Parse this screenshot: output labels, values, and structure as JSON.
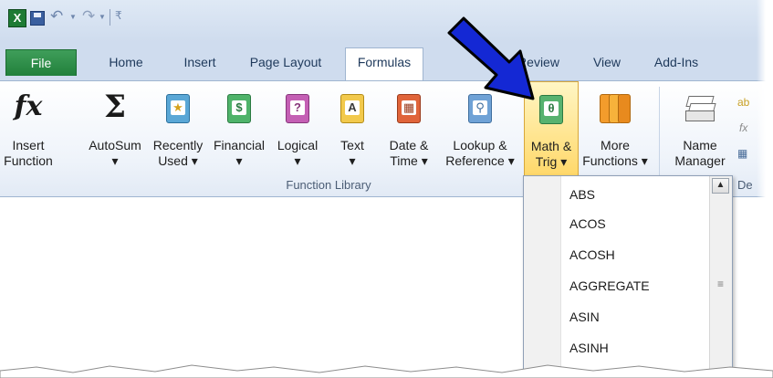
{
  "qat": {
    "app_icon_letter": "X",
    "icons": [
      "excel-app-icon",
      "save-icon",
      "undo-icon",
      "redo-icon",
      "customize-qat-icon"
    ]
  },
  "tabs": [
    {
      "label": "File"
    },
    {
      "label": "Home"
    },
    {
      "label": "Insert"
    },
    {
      "label": "Page Layout"
    },
    {
      "label": "Formulas"
    },
    {
      "label": "Review"
    },
    {
      "label": "View"
    },
    {
      "label": "Add-Ins"
    }
  ],
  "ribbon": {
    "buttons": [
      {
        "label1": "Insert",
        "label2": "Function",
        "icon": "fx-icon"
      },
      {
        "label1": "AutoSum",
        "label2": "▾",
        "icon": "sigma-icon"
      },
      {
        "label1": "Recently",
        "label2": "Used ▾",
        "icon": "recently-used-book-icon"
      },
      {
        "label1": "Financial",
        "label2": "▾",
        "icon": "financial-book-icon"
      },
      {
        "label1": "Logical",
        "label2": "▾",
        "icon": "logical-book-icon"
      },
      {
        "label1": "Text",
        "label2": "▾",
        "icon": "text-book-icon"
      },
      {
        "label1": "Date &",
        "label2": "Time ▾",
        "icon": "date-time-book-icon"
      },
      {
        "label1": "Lookup &",
        "label2": "Reference ▾",
        "icon": "lookup-reference-book-icon"
      },
      {
        "label1": "Math &",
        "label2": "Trig ▾",
        "icon": "math-trig-book-icon"
      },
      {
        "label1": "More",
        "label2": "Functions ▾",
        "icon": "more-functions-books-icon"
      },
      {
        "label1": "Name",
        "label2": "Manager",
        "icon": "name-manager-icon"
      }
    ],
    "group_label": "Function Library",
    "partial_right": "De"
  },
  "dropdown": {
    "items": [
      "ABS",
      "ACOS",
      "ACOSH",
      "AGGREGATE",
      "ASIN",
      "ASINH"
    ],
    "scroll_up": "▲",
    "grip": "≡"
  },
  "colors": {
    "file_tab": "#2c8a45",
    "hot_button": "#ffd86a",
    "arrow": "#1428d4"
  }
}
